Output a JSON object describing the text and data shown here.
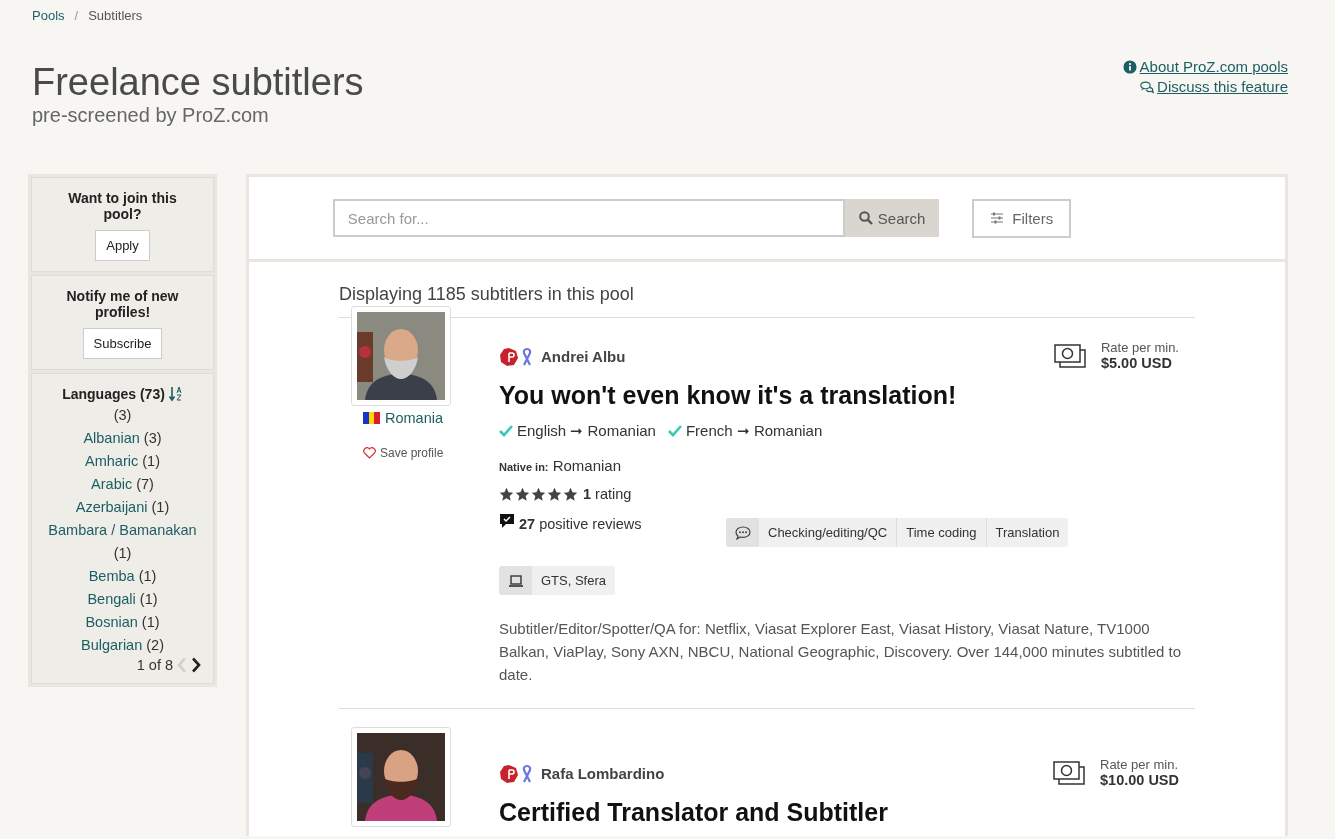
{
  "breadcrumb": [
    {
      "label": "Pools",
      "kind": "link"
    },
    {
      "label": "/",
      "kind": "separator"
    },
    {
      "label": "Subtitlers",
      "kind": "current"
    }
  ],
  "header": {
    "title": "Freelance subtitlers",
    "subtitle": "pre-screened by ProZ.com",
    "links": [
      {
        "label": "About ProZ.com pools"
      },
      {
        "label": "Discuss this feature"
      }
    ]
  },
  "sidebar": {
    "join": {
      "heading": "Want to join this pool?",
      "button": "Apply"
    },
    "notify": {
      "heading": "Notify me of new profiles!",
      "button": "Subscribe"
    },
    "languages": {
      "heading": "Languages (73)",
      "items": [
        {
          "count": "(3)"
        },
        {
          "name": "Albanian",
          "count": "(3)"
        },
        {
          "name": "Amharic",
          "count": "(1)"
        },
        {
          "name": "Arabic",
          "count": "(7)"
        },
        {
          "name": "Azerbaijani",
          "count": "(1)"
        },
        {
          "name": "Bambara / Bamanakan",
          "count": "(1)"
        },
        {
          "name": "Bemba",
          "count": "(1)"
        },
        {
          "name": "Bengali",
          "count": "(1)"
        },
        {
          "name": "Bosnian",
          "count": "(1)"
        },
        {
          "name": "Bulgarian",
          "count": "(2)"
        }
      ],
      "pager": "1 of 8",
      "prev_disabled": true,
      "next_disabled": false
    }
  },
  "search": {
    "placeholder": "Search for...",
    "button": "Search",
    "filters": "Filters"
  },
  "results": {
    "summary": "Displaying 1185 subtitlers in this pool",
    "profiles": [
      {
        "photo": {
          "kind": "picture"
        },
        "country": "Romania",
        "save": "Save profile",
        "name": "Andrei Albu",
        "rate_label": "Rate per min.",
        "rate": "$5.00 USD",
        "headline": "You won't even know it's a translation!",
        "pairs": [
          "English ➞ Romanian",
          "French ➞ Romanian"
        ],
        "native_label": "Native in:",
        "native": "Romanian",
        "stars": 5,
        "rating_count": "1",
        "rating_label": "rating",
        "reviews_count": "27",
        "reviews_label": "positive reviews",
        "services": [
          "Checking/editing/QC",
          "Time coding",
          "Translation"
        ],
        "tools": "GTS, Sfera",
        "bio": "Subtitler/Editor/Spotter/QA for: Netflix, Viasat Explorer East, Viasat History, Viasat Nature, TV1000 Balkan, ViaPlay, Sony AXN, NBCU, National Geographic, Discovery. Over 144,000 minutes subtitled to date."
      },
      {
        "photo": {
          "kind": "picture"
        },
        "name": "Rafa Lombardino",
        "rate_label": "Rate per min.",
        "rate": "$10.00 USD",
        "headline": "Certified Translator and Subtitler"
      }
    ]
  }
}
